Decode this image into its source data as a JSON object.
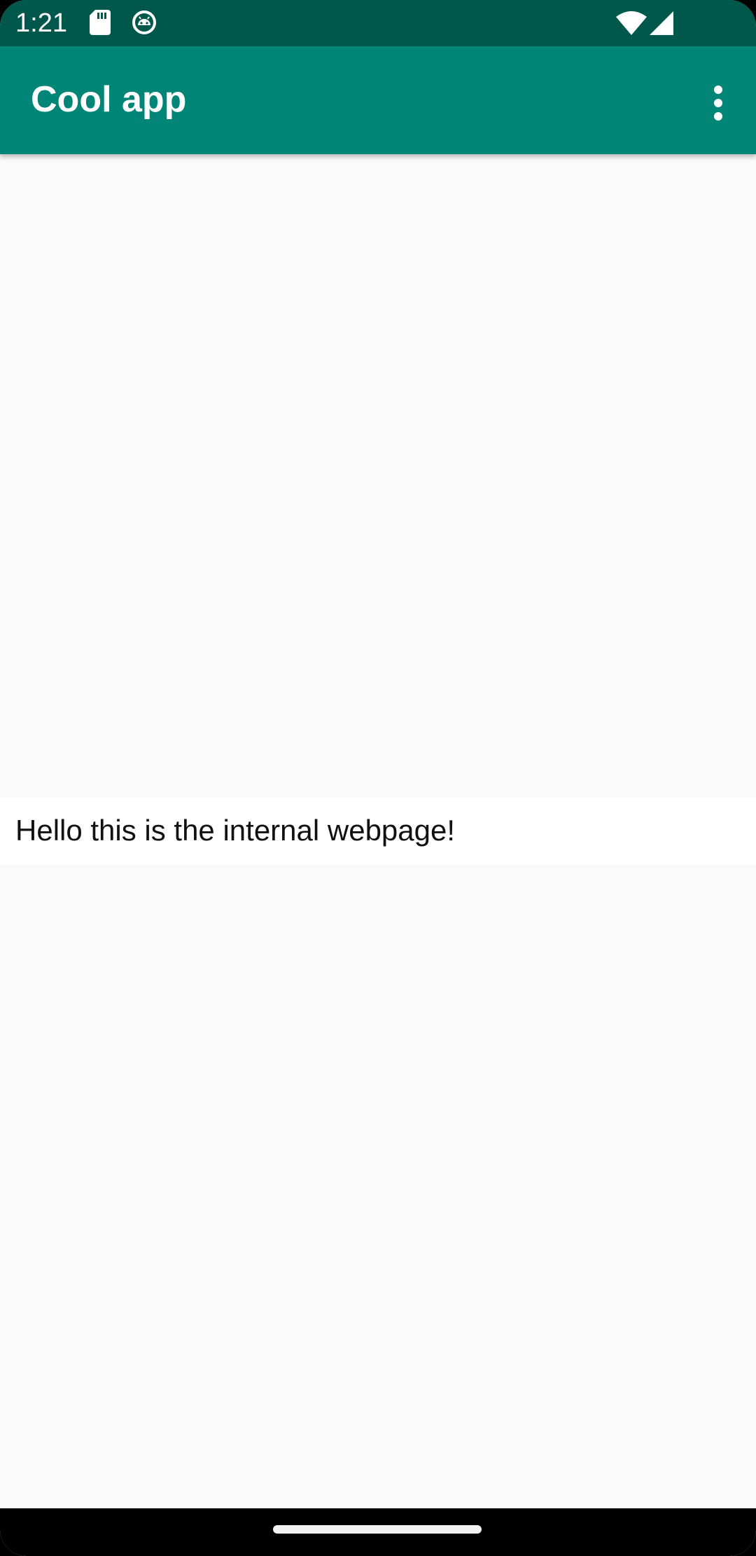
{
  "status_bar": {
    "time": "1:21",
    "background": "#00574b",
    "icons": [
      "sd-card-icon",
      "android-debug-icon",
      "wifi-icon",
      "cell-signal-icon"
    ]
  },
  "app_bar": {
    "title": "Cool app",
    "background": "#008577",
    "overflow_icon": "more-vert-icon"
  },
  "webview": {
    "text": "Hello this is the internal webpage!"
  },
  "colors": {
    "content_background": "#fafafa",
    "webview_background": "#ffffff",
    "nav_bar": "#000000"
  }
}
